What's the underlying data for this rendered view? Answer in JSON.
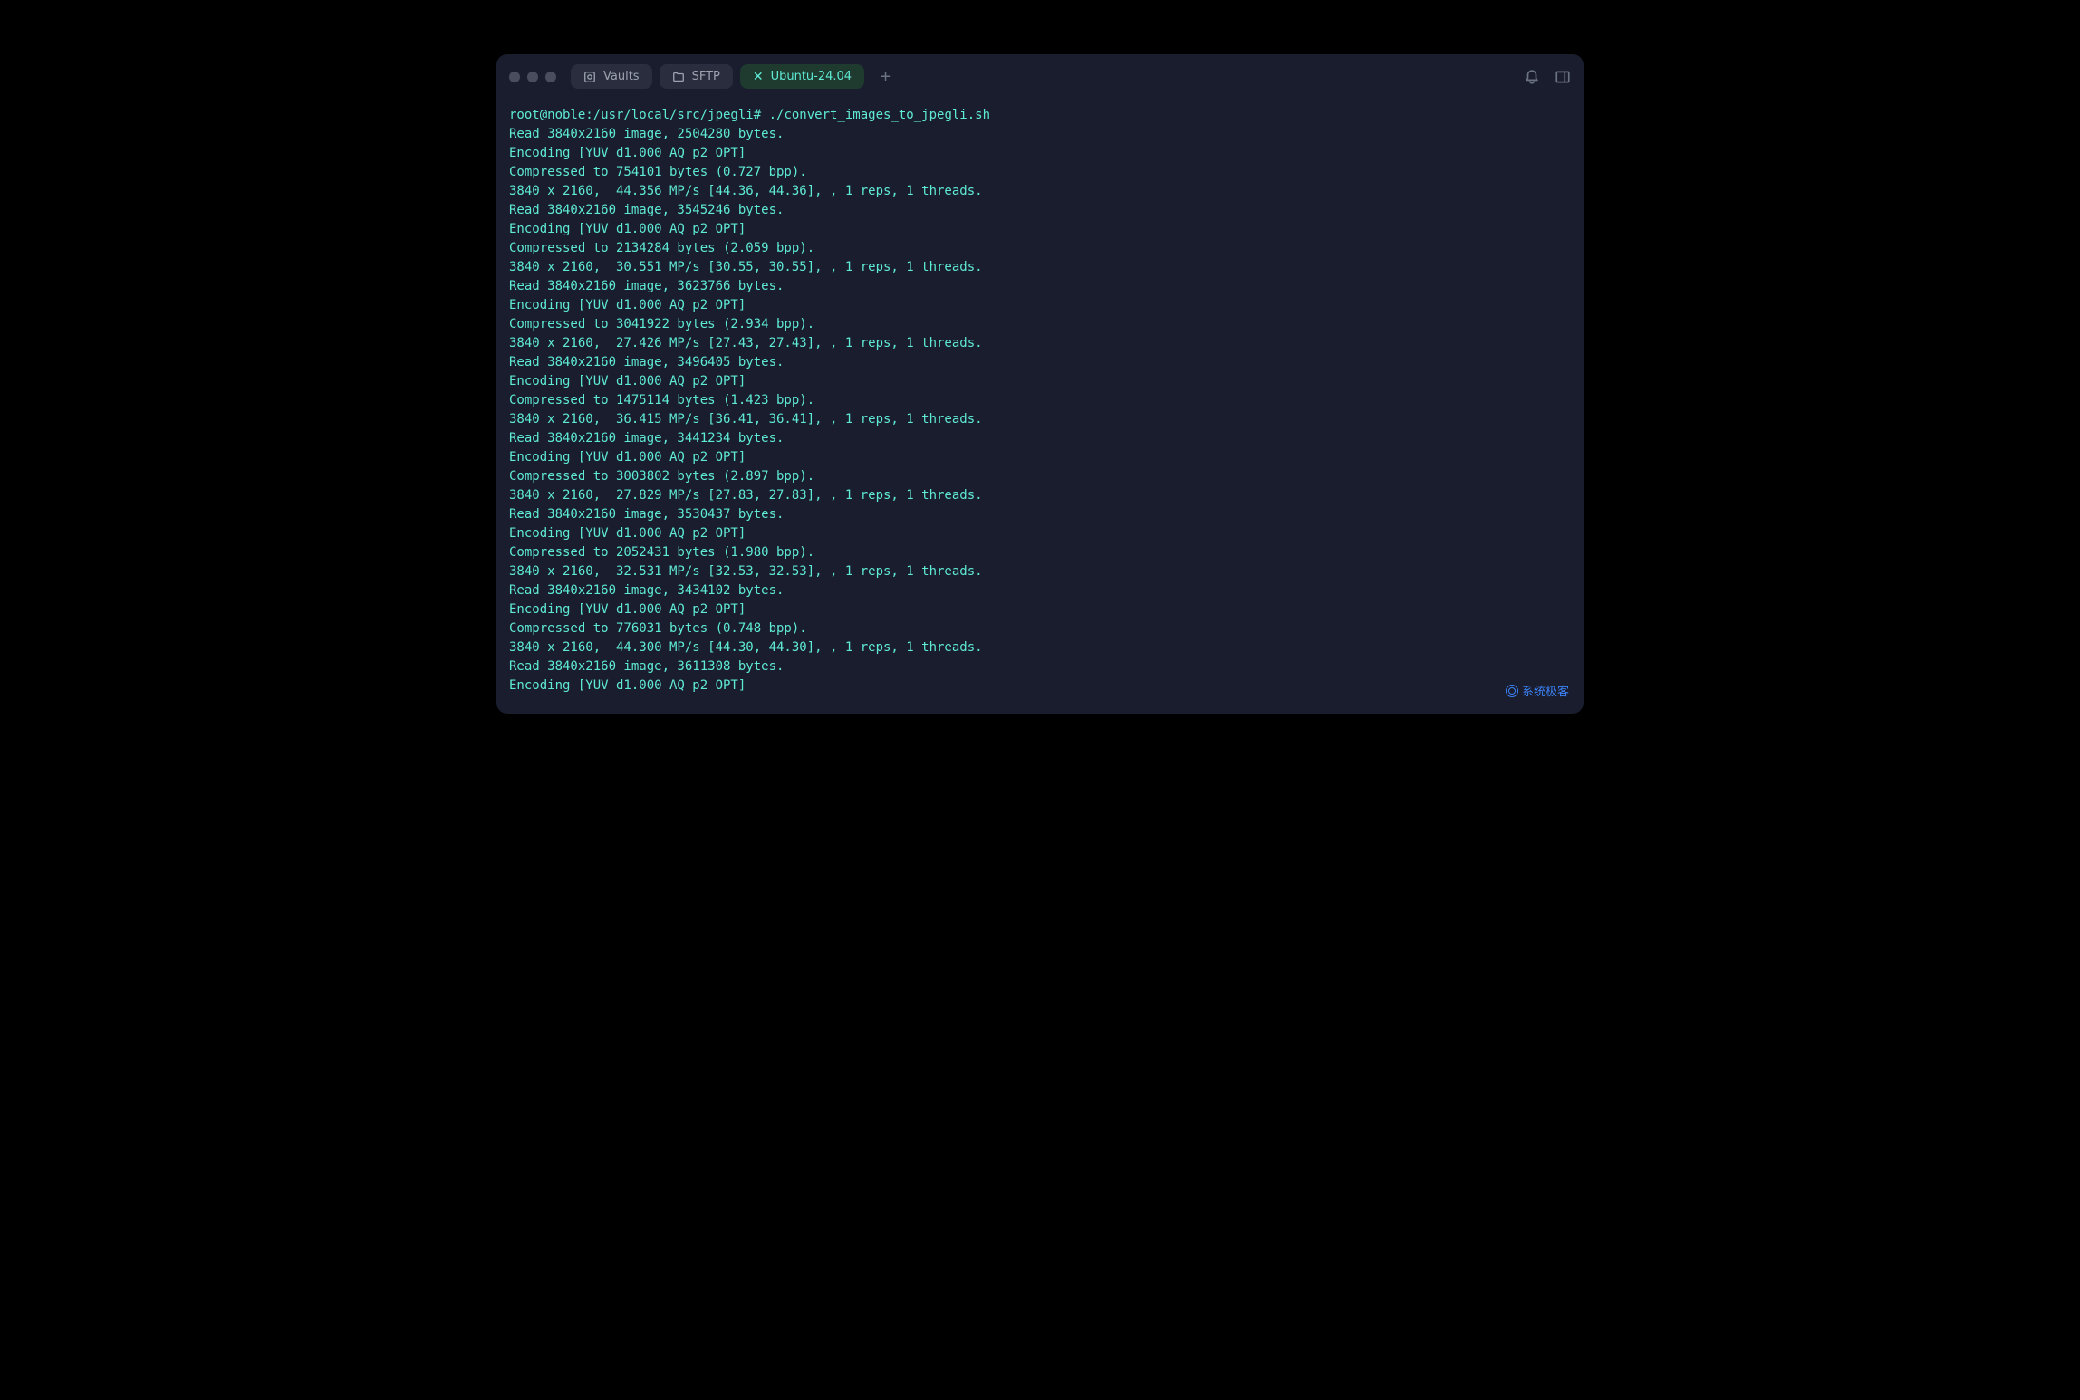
{
  "tabs": {
    "vaults": {
      "label": "Vaults"
    },
    "sftp": {
      "label": "SFTP"
    },
    "ubuntu": {
      "label": "Ubuntu-24.04"
    }
  },
  "prompt": "root@noble:/usr/local/src/jpegli#",
  "command": " ./convert_images_to_jpegli.sh",
  "output": [
    "Read 3840x2160 image, 2504280 bytes.",
    "Encoding [YUV d1.000 AQ p2 OPT]",
    "Compressed to 754101 bytes (0.727 bpp).",
    "3840 x 2160,  44.356 MP/s [44.36, 44.36], , 1 reps, 1 threads.",
    "Read 3840x2160 image, 3545246 bytes.",
    "Encoding [YUV d1.000 AQ p2 OPT]",
    "Compressed to 2134284 bytes (2.059 bpp).",
    "3840 x 2160,  30.551 MP/s [30.55, 30.55], , 1 reps, 1 threads.",
    "Read 3840x2160 image, 3623766 bytes.",
    "Encoding [YUV d1.000 AQ p2 OPT]",
    "Compressed to 3041922 bytes (2.934 bpp).",
    "3840 x 2160,  27.426 MP/s [27.43, 27.43], , 1 reps, 1 threads.",
    "Read 3840x2160 image, 3496405 bytes.",
    "Encoding [YUV d1.000 AQ p2 OPT]",
    "Compressed to 1475114 bytes (1.423 bpp).",
    "3840 x 2160,  36.415 MP/s [36.41, 36.41], , 1 reps, 1 threads.",
    "Read 3840x2160 image, 3441234 bytes.",
    "Encoding [YUV d1.000 AQ p2 OPT]",
    "Compressed to 3003802 bytes (2.897 bpp).",
    "3840 x 2160,  27.829 MP/s [27.83, 27.83], , 1 reps, 1 threads.",
    "Read 3840x2160 image, 3530437 bytes.",
    "Encoding [YUV d1.000 AQ p2 OPT]",
    "Compressed to 2052431 bytes (1.980 bpp).",
    "3840 x 2160,  32.531 MP/s [32.53, 32.53], , 1 reps, 1 threads.",
    "Read 3840x2160 image, 3434102 bytes.",
    "Encoding [YUV d1.000 AQ p2 OPT]",
    "Compressed to 776031 bytes (0.748 bpp).",
    "3840 x 2160,  44.300 MP/s [44.30, 44.30], , 1 reps, 1 threads.",
    "Read 3840x2160 image, 3611308 bytes.",
    "Encoding [YUV d1.000 AQ p2 OPT]"
  ],
  "watermark": "系统极客"
}
